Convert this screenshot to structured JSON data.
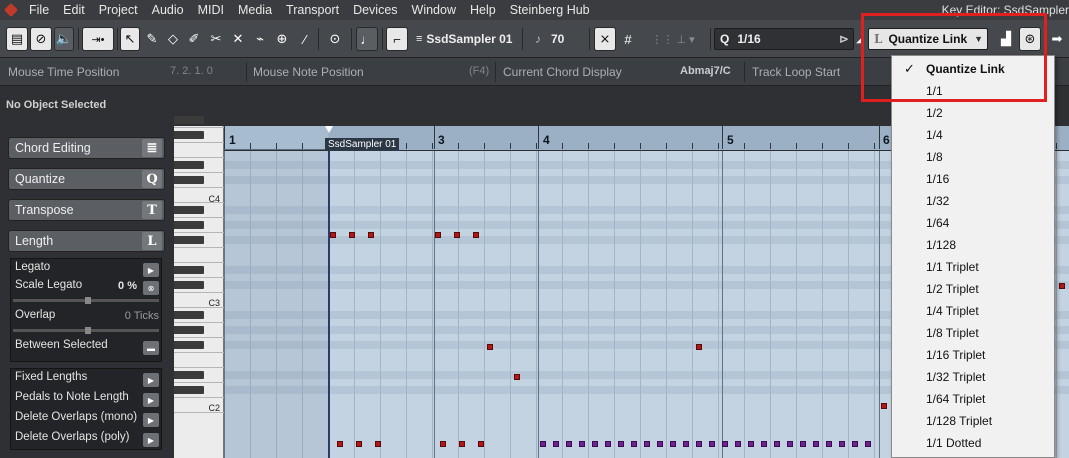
{
  "menubar": {
    "items": [
      "File",
      "Edit",
      "Project",
      "Audio",
      "MIDI",
      "Media",
      "Transport",
      "Devices",
      "Window",
      "Help",
      "Steinberg Hub"
    ],
    "window_title": "Key Editor: SsdSampler"
  },
  "toolbar": {
    "instrument": "SsdSampler 01",
    "velocity": "70",
    "quantize_symbol": "Q",
    "quantize_value": "1/16",
    "length_symbol": "L",
    "length_value": "Quantize Link"
  },
  "infoline": {
    "mouse_time_label": "Mouse Time Position",
    "mouse_time_value": "7. 2. 1.   0",
    "mouse_note_label": "Mouse Note Position",
    "mouse_note_value": "(F4)",
    "chord_label": "Current Chord Display",
    "chord_value": "Abmaj7/C",
    "loop_label": "Track Loop Start"
  },
  "status": {
    "text": "No Object Selected"
  },
  "inspector": {
    "sections": [
      {
        "label": "Chord Editing",
        "icon": "≣"
      },
      {
        "label": "Quantize",
        "icon": "Q"
      },
      {
        "label": "Transpose",
        "icon": "T"
      },
      {
        "label": "Length",
        "icon": "L"
      }
    ],
    "length_rows": {
      "legato": "Legato",
      "scale_legato": "Scale Legato",
      "scale_legato_value": "0 %",
      "overlap": "Overlap",
      "overlap_value": "0 Ticks",
      "between_selected": "Between Selected"
    },
    "actions": [
      "Fixed Lengths",
      "Pedals to Note Length",
      "Delete Overlaps (mono)",
      "Delete Overlaps (poly)"
    ]
  },
  "keyboard": {
    "labels": [
      "C4",
      "C3",
      "C2"
    ]
  },
  "ruler": {
    "bars": [
      "1",
      "3",
      "4",
      "5",
      "6"
    ],
    "event_label": "SsdSampler 01"
  },
  "quantize_menu": {
    "selected": "Quantize Link",
    "items": [
      "Quantize Link",
      "1/1",
      "1/2",
      "1/4",
      "1/8",
      "1/16",
      "1/32",
      "1/64",
      "1/128",
      "1/1 Triplet",
      "1/2 Triplet",
      "1/4 Triplet",
      "1/8 Triplet",
      "1/16 Triplet",
      "1/32 Triplet",
      "1/64 Triplet",
      "1/128 Triplet",
      "1/1 Dotted"
    ]
  },
  "colors": {
    "note_red": "#b01818",
    "note_purple": "#6f2390",
    "highlight": "#e02020",
    "grid_bg": "#c4d3e1"
  }
}
